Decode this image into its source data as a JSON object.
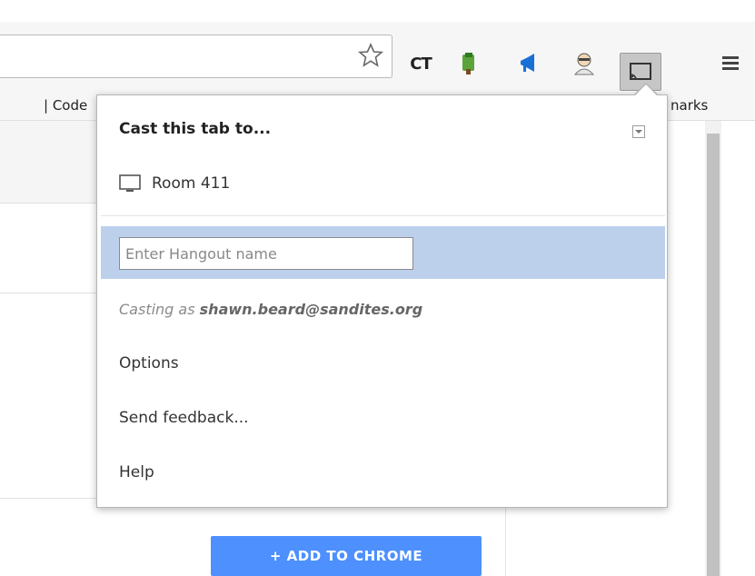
{
  "bookmarks_bar": {
    "left_text": "| Code",
    "right_text": "narks"
  },
  "toolbar": {
    "ext_ct_label": "CT",
    "icons": [
      "star-icon",
      "ct-extension-icon",
      "evernote-icon",
      "announce-icon",
      "avatar-extension-icon",
      "cast-icon",
      "menu-icon"
    ]
  },
  "page": {
    "add_button_label": "+ ADD TO CHROME"
  },
  "cast_popup": {
    "title": "Cast this tab to...",
    "device_name": "Room 411",
    "hangout_placeholder": "Enter Hangout name",
    "casting_as_prefix": "Casting as",
    "casting_as_account": "shawn.beard@sandites.org",
    "menu": [
      {
        "label": "Options"
      },
      {
        "label": "Send feedback..."
      },
      {
        "label": "Help"
      }
    ]
  },
  "colors": {
    "highlight_row": "#bcd0ec",
    "cast_button_active": "#c6c6c6",
    "add_button": "#4d90fe"
  }
}
